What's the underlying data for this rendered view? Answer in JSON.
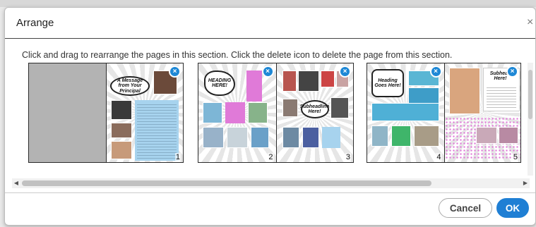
{
  "dialog": {
    "title": "Arrange",
    "close_glyph": "×",
    "instructions": "Click and drag to rearrange the pages in this section. Click the delete icon to delete the page from this section."
  },
  "pages": [
    {
      "number": "1",
      "bubble": "A Message from Your Principal"
    },
    {
      "number": "2",
      "bubble": "HEADING HERE!"
    },
    {
      "number": "3",
      "bubble": "Subheadline Here!"
    },
    {
      "number": "4",
      "bubble": "Heading Goes Here!"
    },
    {
      "number": "5",
      "bubble": "Subhead Here!"
    }
  ],
  "delete_icon": {
    "name": "close-circle-icon",
    "glyph": "×"
  },
  "scroll": {
    "left_glyph": "◀",
    "right_glyph": "▶"
  },
  "footer": {
    "cancel_label": "Cancel",
    "ok_label": "OK"
  },
  "colors": {
    "accent": "#1f7fd4",
    "delete_badge": "#1e88d6",
    "text_block": "#a7d3ee",
    "pink": "#e07ad8"
  }
}
